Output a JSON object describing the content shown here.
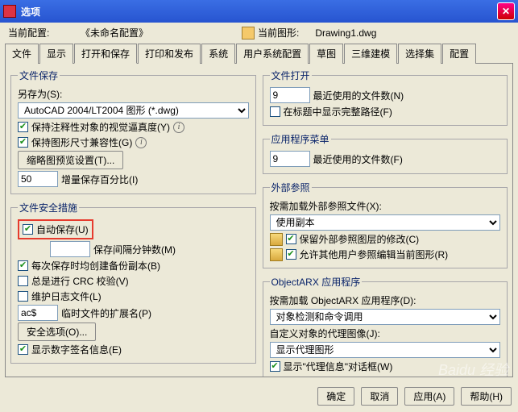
{
  "window": {
    "title": "选项"
  },
  "configRow": {
    "currentConfigLabel": "当前配置:",
    "currentConfigValue": "《未命名配置》",
    "currentDrawingLabel": "当前图形:",
    "currentDrawingValue": "Drawing1.dwg"
  },
  "tabs": [
    "文件",
    "显示",
    "打开和保存",
    "打印和发布",
    "系统",
    "用户系统配置",
    "草图",
    "三维建模",
    "选择集",
    "配置"
  ],
  "activeTab": "打开和保存",
  "left": {
    "fileSave": {
      "legend": "文件保存",
      "saveAsLabel": "另存为(S):",
      "saveAsValue": "AutoCAD 2004/LT2004 图形 (*.dwg)",
      "keepAnnot": "保持注释性对象的视觉逼真度(Y)",
      "keepSize": "保持图形尺寸兼容性(G)",
      "thumbBtn": "缩略图预览设置(T)...",
      "incVal": "50",
      "incLabel": "增量保存百分比(I)"
    },
    "fileSec": {
      "legend": "文件安全措施",
      "autoSave": "自动保存(U)",
      "intervalVal": "",
      "intervalLabel": "保存间隔分钟数(M)",
      "backup": "每次保存时均创建备份副本(B)",
      "crc": "总是进行 CRC 校验(V)",
      "log": "维护日志文件(L)",
      "extVal": "ac$",
      "extLabel": "临时文件的扩展名(P)",
      "secBtn": "安全选项(O)...",
      "sig": "显示数字签名信息(E)"
    }
  },
  "right": {
    "fileOpen": {
      "legend": "文件打开",
      "recentVal": "9",
      "recentLabel": "最近使用的文件数(N)",
      "fullPath": "在标题中显示完整路径(F)"
    },
    "appMenu": {
      "legend": "应用程序菜单",
      "recentVal": "9",
      "recentLabel": "最近使用的文件数(F)"
    },
    "xref": {
      "legend": "外部参照",
      "loadLabel": "按需加载外部参照文件(X):",
      "loadValue": "使用副本",
      "keepLayer": "保留外部参照图层的修改(C)",
      "allowEdit": "允许其他用户参照编辑当前图形(R)"
    },
    "arx": {
      "legend": "ObjectARX 应用程序",
      "loadLabel": "按需加载 ObjectARX 应用程序(D):",
      "loadValue": "对象检测和命令调用",
      "proxyLabel": "自定义对象的代理图像(J):",
      "proxyValue": "显示代理图形",
      "proxyDlg": "显示\"代理信息\"对话框(W)"
    }
  },
  "footer": {
    "ok": "确定",
    "cancel": "取消",
    "apply": "应用(A)",
    "help": "帮助(H)"
  },
  "watermark": "Baidu 经验"
}
